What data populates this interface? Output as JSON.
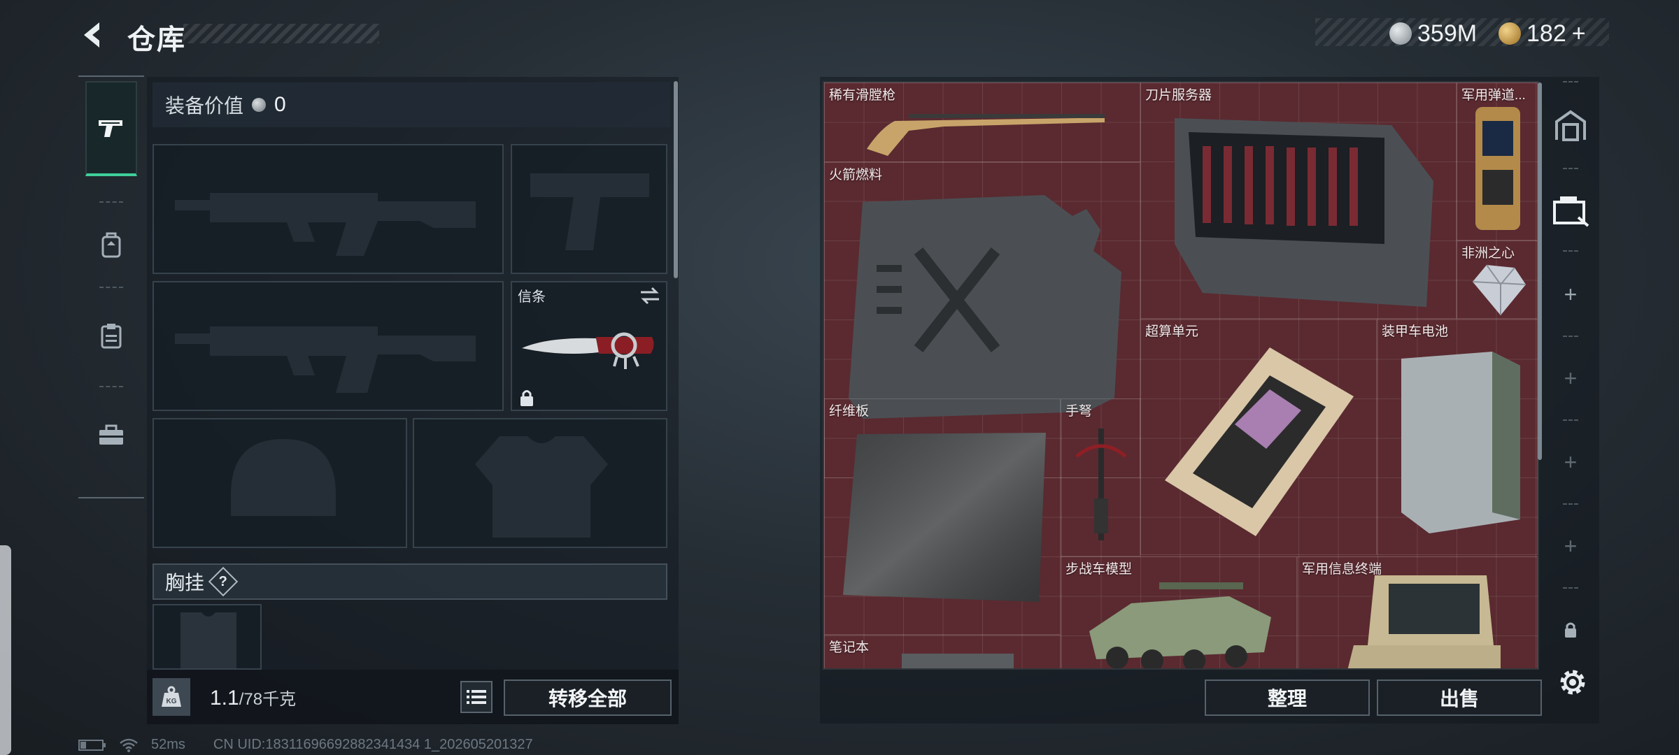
{
  "header": {
    "title": "仓库",
    "back_icon": "back-arrow-icon"
  },
  "currency": {
    "silver": {
      "icon": "silver-coin-icon",
      "value": "359M",
      "color": "#9aa3aa"
    },
    "gold": {
      "icon": "gold-coin-icon",
      "value": "182",
      "plus": "+",
      "color": "#c79a3c"
    }
  },
  "rail": {
    "items": [
      {
        "icon": "pistol-icon",
        "active": true
      },
      {
        "icon": "backpack-icon",
        "active": false
      },
      {
        "icon": "clipboard-icon",
        "active": false
      },
      {
        "icon": "toolbox-icon",
        "active": false
      }
    ],
    "accent": "#3fcf9a"
  },
  "equipment": {
    "value_label": "装备价值",
    "value": "0",
    "slots": {
      "primary1": {
        "icon": "rifle-silhouette-icon"
      },
      "pistol": {
        "icon": "pistol-silhouette-icon"
      },
      "primary2": {
        "icon": "rifle-silhouette-icon"
      },
      "melee": {
        "label": "信条",
        "icon": "knife-icon",
        "swap_icon": "swap-icon",
        "lock_icon": "lock-icon"
      },
      "helmet": {
        "icon": "helmet-silhouette-icon"
      },
      "armor": {
        "icon": "armor-silhouette-icon"
      }
    },
    "chest_rig_label": "胸挂",
    "chest_rig_help": "?"
  },
  "footer_left": {
    "weight_current": "1.1",
    "weight_max": "/78千克",
    "kg_icon": "kg-weight-icon",
    "list_icon": "list-icon",
    "transfer_all": "转移全部"
  },
  "stash": {
    "background": "#5a2a30",
    "items": [
      {
        "label": "稀有滑膛枪",
        "icon": "musket-icon"
      },
      {
        "label": "刀片服务器",
        "icon": "blade-server-icon"
      },
      {
        "label": "军用弹道...",
        "icon": "ballistic-computer-icon"
      },
      {
        "label": "火箭燃料",
        "icon": "fuel-can-icon"
      },
      {
        "label": "非洲之心",
        "icon": "diamond-icon"
      },
      {
        "label": "超算单元",
        "icon": "supercomputer-board-icon"
      },
      {
        "label": "装甲车电池",
        "icon": "battery-icon"
      },
      {
        "label": "纤维板",
        "icon": "carbon-fiber-board-icon"
      },
      {
        "label": "手弩",
        "icon": "crossbow-icon"
      },
      {
        "label": "步战车模型",
        "icon": "ifv-model-icon"
      },
      {
        "label": "军用信息终端",
        "icon": "military-terminal-icon"
      },
      {
        "label": "笔记本",
        "icon": "laptop-icon"
      }
    ]
  },
  "side_rail": {
    "buttons": [
      "vault-icon",
      "cash-register-icon",
      "plus-icon",
      "plus-icon",
      "plus-icon",
      "plus-icon",
      "lock-icon"
    ]
  },
  "actions": {
    "sort": "整理",
    "sell": "出售",
    "settings_icon": "gear-icon"
  },
  "status": {
    "battery_icon": "battery-status-icon",
    "wifi_icon": "wifi-icon",
    "ping": "52ms",
    "uid": "CN UID:18311696692882341434 1_202605201327"
  }
}
